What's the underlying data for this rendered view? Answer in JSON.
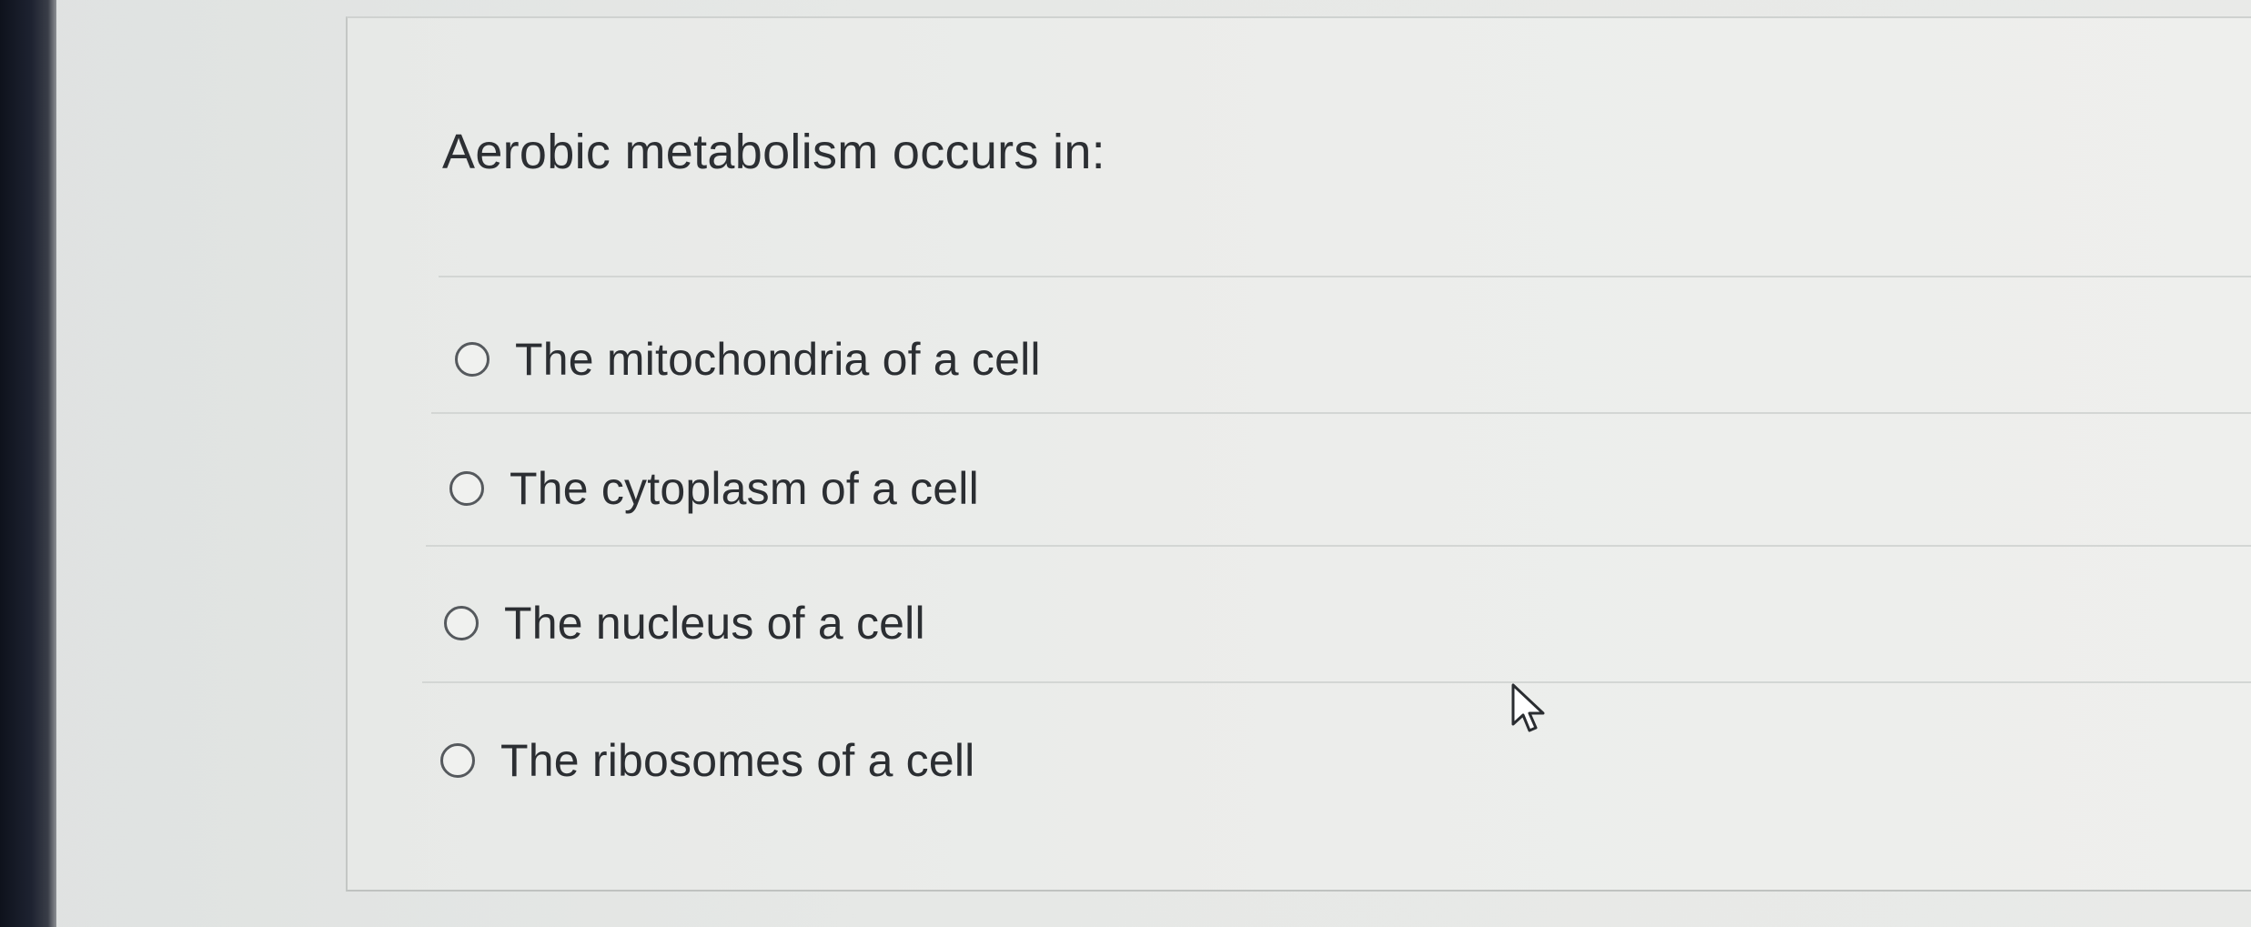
{
  "question": {
    "title": "Aerobic metabolism occurs in:",
    "options": [
      {
        "label": "The mitochondria of a cell",
        "selected": false
      },
      {
        "label": "The cytoplasm of a cell",
        "selected": false
      },
      {
        "label": "The nucleus of a cell",
        "selected": false
      },
      {
        "label": "The ribosomes of a cell",
        "selected": false
      }
    ]
  },
  "cursor": {
    "icon": "mouse-pointer-arrow-icon"
  }
}
